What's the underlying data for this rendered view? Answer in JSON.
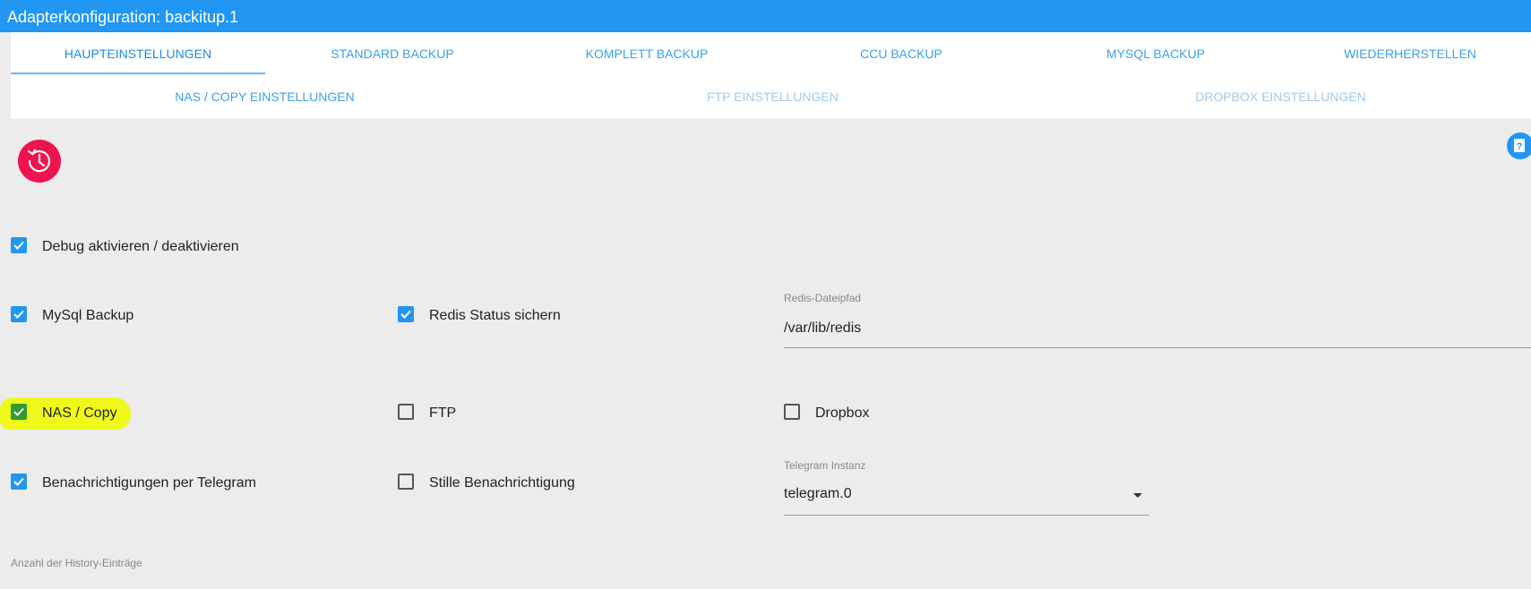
{
  "window": {
    "title": "Adapterkonfiguration: backitup.1"
  },
  "tabs": {
    "row1": [
      {
        "label": "HAUPTEINSTELLUNGEN"
      },
      {
        "label": "STANDARD BACKUP"
      },
      {
        "label": "KOMPLETT BACKUP"
      },
      {
        "label": "CCU BACKUP"
      },
      {
        "label": "MYSQL BACKUP"
      },
      {
        "label": "WIEDERHERSTELLEN"
      }
    ],
    "row2": [
      {
        "label": "NAS / COPY EINSTELLUNGEN"
      },
      {
        "label": "FTP EINSTELLUNGEN"
      },
      {
        "label": "DROPBOX EINSTELLUNGEN"
      }
    ],
    "active": "HAUPTEINSTELLUNGEN"
  },
  "options": {
    "debug": {
      "label": "Debug aktivieren / deaktivieren",
      "checked": true
    },
    "mysql": {
      "label": "MySql Backup",
      "checked": true
    },
    "redis": {
      "label": "Redis Status sichern",
      "checked": true
    },
    "nas": {
      "label": "NAS / Copy",
      "checked": true
    },
    "ftp": {
      "label": "FTP",
      "checked": false
    },
    "dropbox": {
      "label": "Dropbox",
      "checked": false
    },
    "telegram": {
      "label": "Benachrichtigungen per Telegram",
      "checked": true
    },
    "silent": {
      "label": "Stille Benachrichtigung",
      "checked": false
    }
  },
  "fields": {
    "redis_path": {
      "label": "Redis-Dateipfad",
      "value": "/var/lib/redis"
    },
    "telegram_instance": {
      "label": "Telegram Instanz",
      "value": "telegram.0"
    },
    "history": {
      "label": "Anzahl der History-Einträge"
    }
  },
  "colors": {
    "accent": "#2196f3",
    "logo": "#f0134d",
    "highlight": "#eef91a"
  },
  "icons": {
    "logo": "clock-history-icon",
    "help": "help-icon",
    "check": "check-icon",
    "dropdown": "caret-down-icon"
  }
}
